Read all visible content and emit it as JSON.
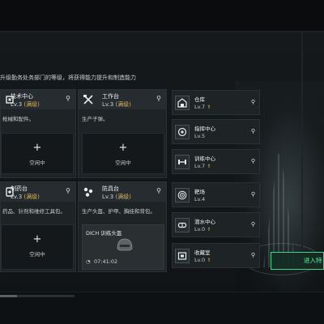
{
  "header": {
    "subtitle": "升级勤务处务部门的等级，将获得能力提升和制造能力"
  },
  "left_cards": [
    {
      "name": "技术中心",
      "level": "Lv.3",
      "status": "(满级)",
      "desc": "枪械和配件。",
      "icon": "chip-icon",
      "slot": {
        "plus": "+",
        "label": "空闲中"
      }
    },
    {
      "name": "工作台",
      "level": "Lv.3",
      "status": "(满级)",
      "desc": "生产子弹。",
      "icon": "tools-icon",
      "slot": {
        "plus": "+",
        "label": "空闲中"
      }
    },
    {
      "name": "制药台",
      "level": "Lv.3",
      "status": "(满级)",
      "desc": "药品、针剂和维修工具包。",
      "icon": "pill-icon",
      "slot": {
        "plus": "+",
        "label": "空闲中"
      }
    },
    {
      "name": "防具台",
      "level": "Lv.3",
      "status": "(满级)",
      "desc": "生产头盔、护甲、胸挂和背包。",
      "icon": "armor-icon",
      "production": {
        "item": "DICH 训练头盔",
        "time": "07:41:02"
      }
    }
  ],
  "right_list": [
    {
      "name": "仓库",
      "level": "Lv.7",
      "upgrade": "⇑",
      "icon": "warehouse-icon"
    },
    {
      "name": "指挥中心",
      "level": "Lv.5",
      "upgrade": "",
      "icon": "command-icon"
    },
    {
      "name": "训练中心",
      "level": "Lv.7",
      "upgrade": "⇑",
      "icon": "dumbbell-icon"
    },
    {
      "name": "靶场",
      "level": "Lv.4",
      "upgrade": "",
      "icon": "target-icon"
    },
    {
      "name": "潜水中心",
      "level": "Lv.0",
      "upgrade": "⇑",
      "icon": "diving-icon"
    },
    {
      "name": "收藏室",
      "level": "Lv.0",
      "upgrade": "⇑",
      "icon": "collection-icon"
    }
  ],
  "enter_button": {
    "label": "进入特"
  },
  "progress": {
    "value": 0.23
  },
  "colors": {
    "accent_green": "#3fd58a",
    "maxed_gold": "#d8b25a",
    "card_bg": "#1e2326"
  }
}
